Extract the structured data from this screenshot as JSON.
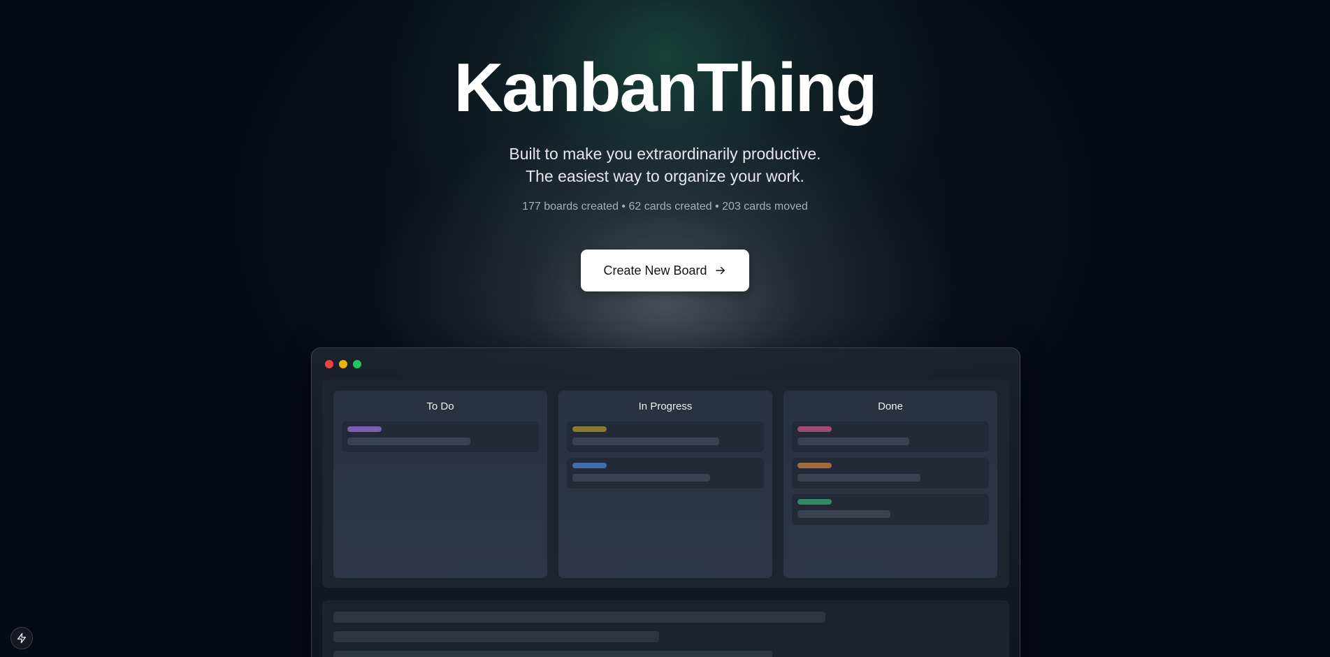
{
  "hero": {
    "title": "KanbanThing",
    "tagline_line1": "Built to make you extraordinarily productive.",
    "tagline_line2": "The easiest way to organize your work.",
    "stats": "177 boards created • 62 cards created • 203 cards moved"
  },
  "cta": {
    "label": "Create New Board",
    "icon": "arrow-right-icon"
  },
  "preview": {
    "window_controls": [
      {
        "name": "close",
        "color": "#ef4444"
      },
      {
        "name": "minimize",
        "color": "#eab308"
      },
      {
        "name": "maximize",
        "color": "#22c55e"
      }
    ],
    "columns": [
      {
        "title": "To Do",
        "cards": [
          {
            "tag_color": "#7c5fb0",
            "line_fraction": 0.66
          }
        ]
      },
      {
        "title": "In Progress",
        "cards": [
          {
            "tag_color": "#8a7a2e",
            "line_fraction": 0.79
          },
          {
            "tag_color": "#3f6fae",
            "line_fraction": 0.74
          }
        ]
      },
      {
        "title": "Done",
        "cards": [
          {
            "tag_color": "#a04a78",
            "line_fraction": 0.6
          },
          {
            "tag_color": "#a06a3a",
            "line_fraction": 0.66
          },
          {
            "tag_color": "#2f8a62",
            "line_fraction": 0.5
          }
        ]
      }
    ],
    "footer_lines": [
      0.74,
      0.49,
      0.66
    ]
  },
  "corner_button": {
    "icon": "lightning-icon"
  }
}
